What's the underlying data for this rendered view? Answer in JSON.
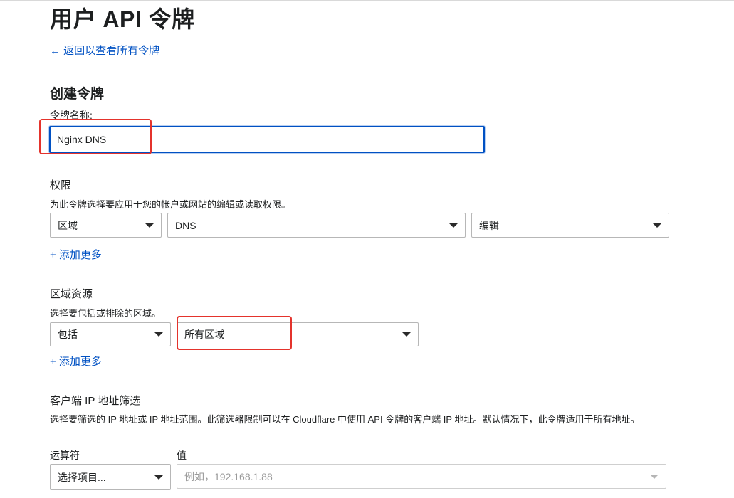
{
  "page": {
    "title": "用户 API 令牌",
    "back_link": "← 返回以查看所有令牌"
  },
  "create": {
    "section_title": "创建令牌",
    "token_name_label": "令牌名称:",
    "token_name_value": "Nginx DNS"
  },
  "permissions": {
    "title": "权限",
    "description": "为此令牌选择要应用于您的帐户或网站的编辑或读取权限。",
    "scope": "区域",
    "resource": "DNS",
    "access": "编辑",
    "add_more": "+ 添加更多"
  },
  "zone_resources": {
    "title": "区域资源",
    "description": "选择要包括或排除的区域。",
    "include": "包括",
    "zones": "所有区域",
    "add_more": "+ 添加更多"
  },
  "ip_filter": {
    "title": "客户端 IP 地址筛选",
    "description": "选择要筛选的 IP 地址或 IP 地址范围。此筛选器限制可以在 Cloudflare 中使用 API 令牌的客户端 IP 地址。默认情况下，此令牌适用于所有地址。",
    "operator_label": "运算符",
    "value_label": "值",
    "operator_placeholder": "选择项目...",
    "value_placeholder": "例如，192.168.1.88"
  },
  "colors": {
    "link": "#0051c3",
    "focus": "#0051c3",
    "highlight": "#e4332c"
  }
}
